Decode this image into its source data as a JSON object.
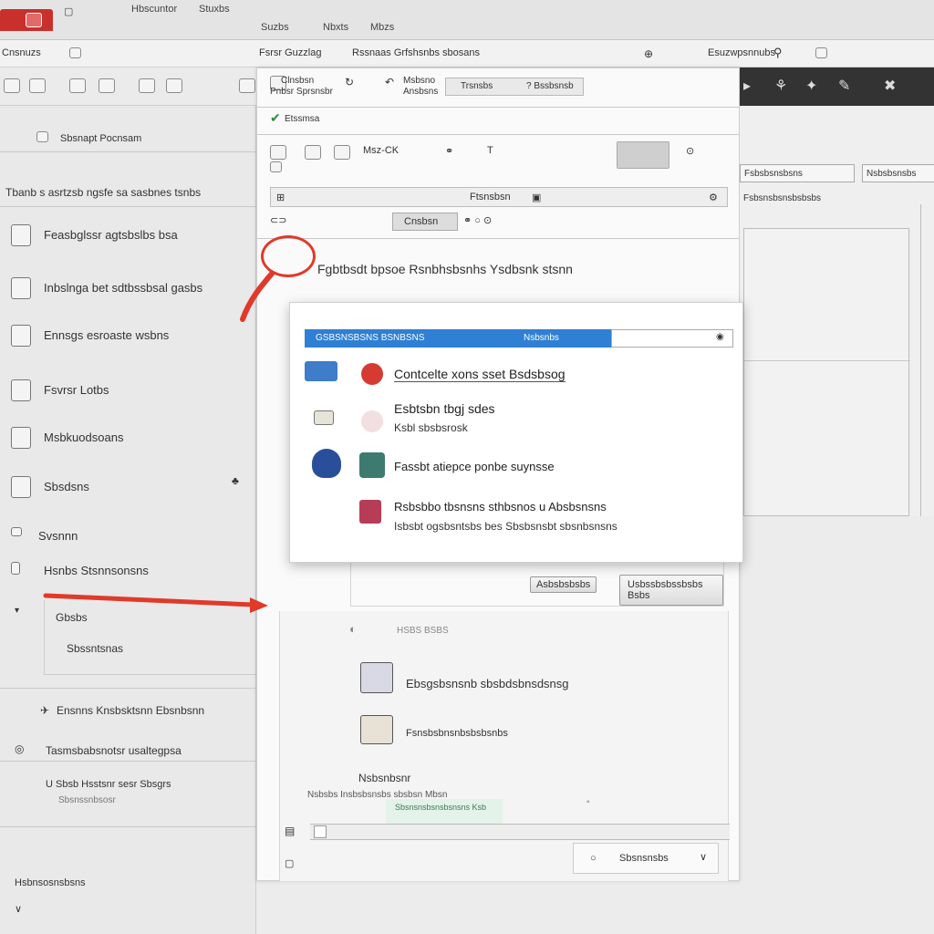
{
  "tabs": [
    "Hbscuntor",
    "Stuxbs",
    "Suzbs",
    "Nbxts",
    "Mbzs"
  ],
  "addressbar": {
    "left": "Cnsnuzs",
    "path": "Fsrsr Guzzlag",
    "path2": "Rssnaas Grfshsnbs sbosans",
    "right_field": "Esuzwpsnnubs"
  },
  "sidebar": {
    "search_label": "Sbsnapt Pocnsam",
    "header": "Tbanb s asrtzsb ngsfe sa sasbnes tsnbs",
    "items": [
      "Feasbglssr agtsbslbs bsa",
      "Inbslnga bet sdtbssbsal gasbs",
      "Ennsgs esroaste wsbns",
      "Fsvrsr Lotbs",
      "Msbkuodsoans",
      "Sbsdsns",
      "Svsnnn",
      "Hsnbs Stsnnsonsns"
    ],
    "subitems": [
      "Gbsbs",
      "Sbssntsnas"
    ],
    "footer_items": [
      "Ensnns Knsbsktsnn Ebsnbsnn",
      "Tasmsbabsnotsr usaltegpsa",
      "U Sbsb Hsstsnr sesr Sbsgrs",
      "Sbsnssnbsosr"
    ],
    "bottom": "Hsbnsosnsbsns"
  },
  "center": {
    "toolbar_left": "Clnsbsn",
    "toolbar_left2": "Pnbsr Sprsnsbr",
    "toolbar_mid": "Msbsno",
    "toolbar_mid2": "Ansbsns",
    "toolbar_field": "Trsnsbs",
    "toolbar_help": "? Bssbsnsb",
    "green_label": "Etssmsa",
    "row2_label": "Msz-CK",
    "search_label": "Ftsnsbsn",
    "tab_label": "Cnsbsn",
    "heading": "Fgbtbsdt bpsoe Rsnbhsbsnhs Ysdbsnk stsnn",
    "cancel_label": "Asbsbsbsbs",
    "ok_label": "Usbssbsbssbsbs Bsbs",
    "section_label": "HSBS BSBS",
    "row1_label": "Ebsgsbsnsnb sbsbdsbnsdsnsg",
    "row2_label2": "Fsnsbsbnsnbsbsbsnbs",
    "notice_label": "Nsbsnbsnr",
    "notice_text": "Nsbsbs Insbsbsnsbs sbsbsn Mbsn",
    "notice_highlight": "Sbsnsnsbsnsbsnsns Ksb",
    "status_label": "Sbsnsnsbs"
  },
  "modal": {
    "bar_text": "GSBSNSBSNS BSNBSNS",
    "bar_right": "Nsbsnbs",
    "items": [
      {
        "label": "Contcelte xons sset Bsdsbsog",
        "sub": ""
      },
      {
        "label": "Esbtsbn tbgj sdes",
        "sub": "Ksbl sbsbsrosk"
      },
      {
        "label": "Fassbt atiepce ponbe suynsse",
        "sub": ""
      },
      {
        "label": "Rsbsbbo tbsnsns sthbsnos u Absbsnsns",
        "sub": "Isbsbt ogsbsntsbs bes Sbsbsnsbt sbsnbsnsns"
      }
    ]
  },
  "rightpanel": {
    "field1": "Fsbsbsnsbsns",
    "field2": "Nsbsbsnsbs",
    "row": "Fsbsnsbsnsbsbsbs"
  }
}
